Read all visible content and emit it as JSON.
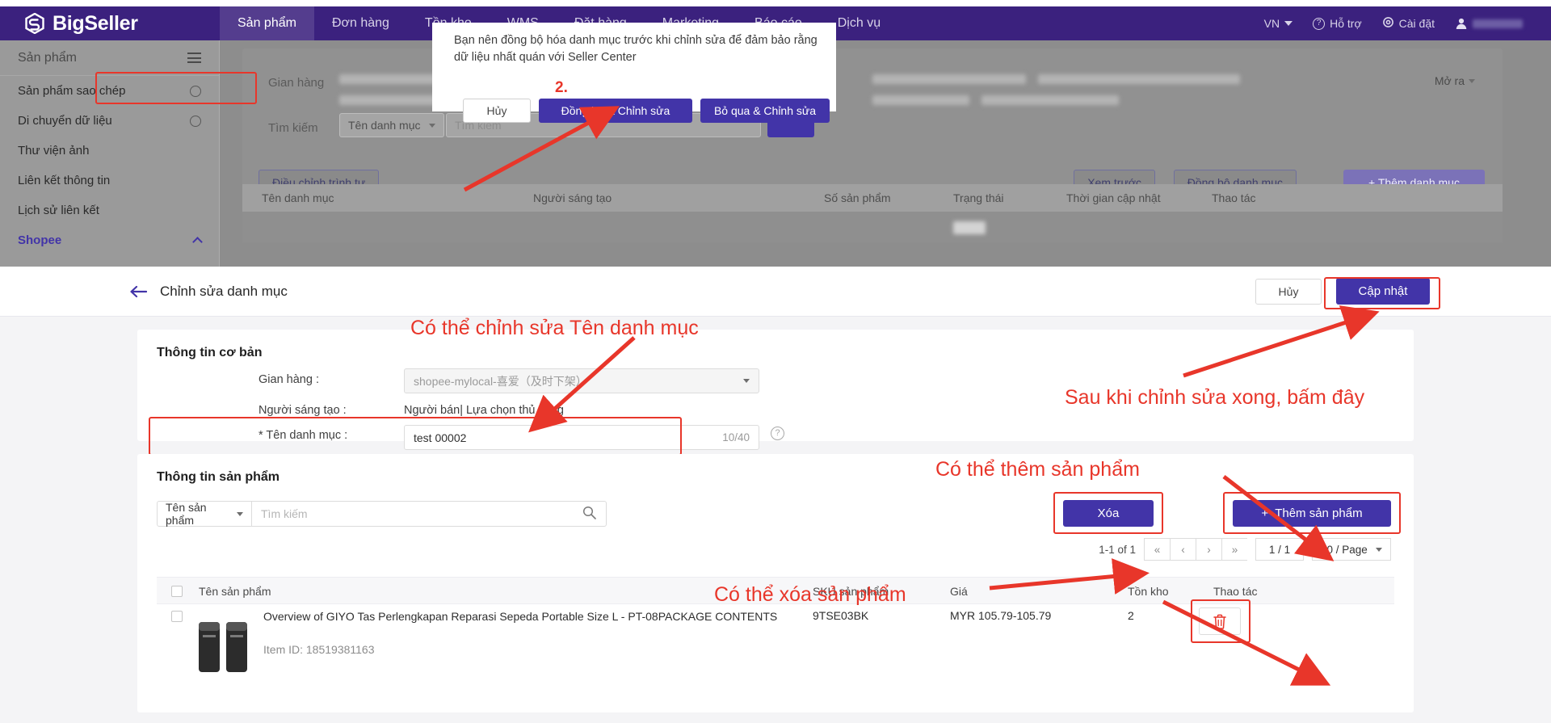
{
  "app": {
    "brand": "BigSeller",
    "logo_icon": "bigseller-logo-icon"
  },
  "topnav": {
    "items": [
      {
        "label": "Sản phẩm",
        "active": true
      },
      {
        "label": "Đơn hàng",
        "active": false
      },
      {
        "label": "Tồn kho",
        "active": false
      },
      {
        "label": "WMS",
        "active": false
      },
      {
        "label": "Đặt hàng",
        "active": false
      },
      {
        "label": "Marketing",
        "active": false
      },
      {
        "label": "Báo cáo",
        "active": false
      },
      {
        "label": "Dịch vụ",
        "active": false
      }
    ],
    "right": {
      "language": "VN",
      "support": "Hỗ trợ",
      "settings": "Cài đặt"
    }
  },
  "sidebar": {
    "header": "Sản phẩm",
    "items": [
      {
        "label": "Sản phẩm sao chép",
        "has_gear": true
      },
      {
        "label": "Di chuyển dữ liệu",
        "has_gear": true
      },
      {
        "label": "Thư viện ảnh",
        "has_gear": false
      },
      {
        "label": "Liên kết thông tin",
        "has_gear": false
      },
      {
        "label": "Lịch sử liên kết",
        "has_gear": false
      }
    ],
    "channel": "Shopee"
  },
  "background_page": {
    "shop_label": "Gian hàng",
    "search_label": "Tìm kiếm",
    "category_select": "Tên danh mục",
    "search_placeholder": "Tìm kiếm",
    "more_open": "Mở ra",
    "buttons": {
      "adjust_order": "Điều chỉnh trình tự",
      "preview": "Xem trước",
      "sync_category": "Đồng bộ danh mục",
      "add_category": "+ Thêm danh mục"
    },
    "table_headers": [
      "Tên danh mục",
      "Người sáng tạo",
      "Số sản phẩm",
      "Trạng thái",
      "Thời gian cập nhật",
      "Thao tác"
    ]
  },
  "modal": {
    "message": "Bạn nên đồng bộ hóa danh mục trước khi chỉnh sửa để đảm bảo rằng dữ liệu nhất quán với Seller Center",
    "step_number": "2.",
    "cancel": "Hủy",
    "sync_and_edit": "Đồng bộ & Chỉnh sửa",
    "skip_and_edit": "Bỏ qua & Chỉnh sửa"
  },
  "page": {
    "title": "Chỉnh sửa danh mục",
    "back_icon": "back-arrow-icon",
    "cancel": "Hủy",
    "update": "Cập nhật"
  },
  "basic_info": {
    "section_title": "Thông tin cơ bản",
    "shop_label": "Gian hàng :",
    "shop_value": "shopee-mylocal-喜爱（及时下架）",
    "creator_label": "Người sáng tạo :",
    "creator_value": "Người bán| Lựa chọn thủ công",
    "name_label": "* Tên danh mục :",
    "name_value": "test 00002",
    "name_counter": "10/40",
    "help_icon": "question-mark-icon"
  },
  "product_info": {
    "section_title": "Thông tin sản phẩm",
    "filter_select": "Tên sản phẩm",
    "search_placeholder": "Tìm kiếm",
    "search_icon": "search-icon",
    "delete_button": "Xóa",
    "add_button": "Thêm sản phẩm",
    "add_icon": "plus-icon",
    "pagination": {
      "range": "1-1 of 1",
      "first": "«",
      "prev": "‹",
      "next": "›",
      "last": "»",
      "current": "1 / 1",
      "page_size": "50 / Page"
    },
    "table_headers": [
      "Tên sản phẩm",
      "SKU sản phẩm",
      "Giá",
      "Tồn kho",
      "Thao tác"
    ],
    "rows": [
      {
        "name": "Overview of GIYO Tas Perlengkapan Reparasi Sepeda Portable Size L - PT-08PACKAGE CONTENTS",
        "item_id": "Item ID: 18519381163",
        "sku": "9TSE03BK",
        "price": "MYR 105.79-105.79",
        "stock": "2",
        "action_icon": "trash-icon"
      }
    ]
  },
  "annotations": {
    "edit_name": "Có thể chỉnh sửa Tên danh mục",
    "after_edit": "Sau khi chỉnh sửa xong, bấm đây",
    "can_add": "Có thể thêm sản phẩm",
    "can_delete": "Có thể xóa sản phẩm"
  },
  "colors": {
    "brand_purple": "#3b217e",
    "accent_purple": "#4234a8",
    "annotation_red": "#e8362a"
  }
}
